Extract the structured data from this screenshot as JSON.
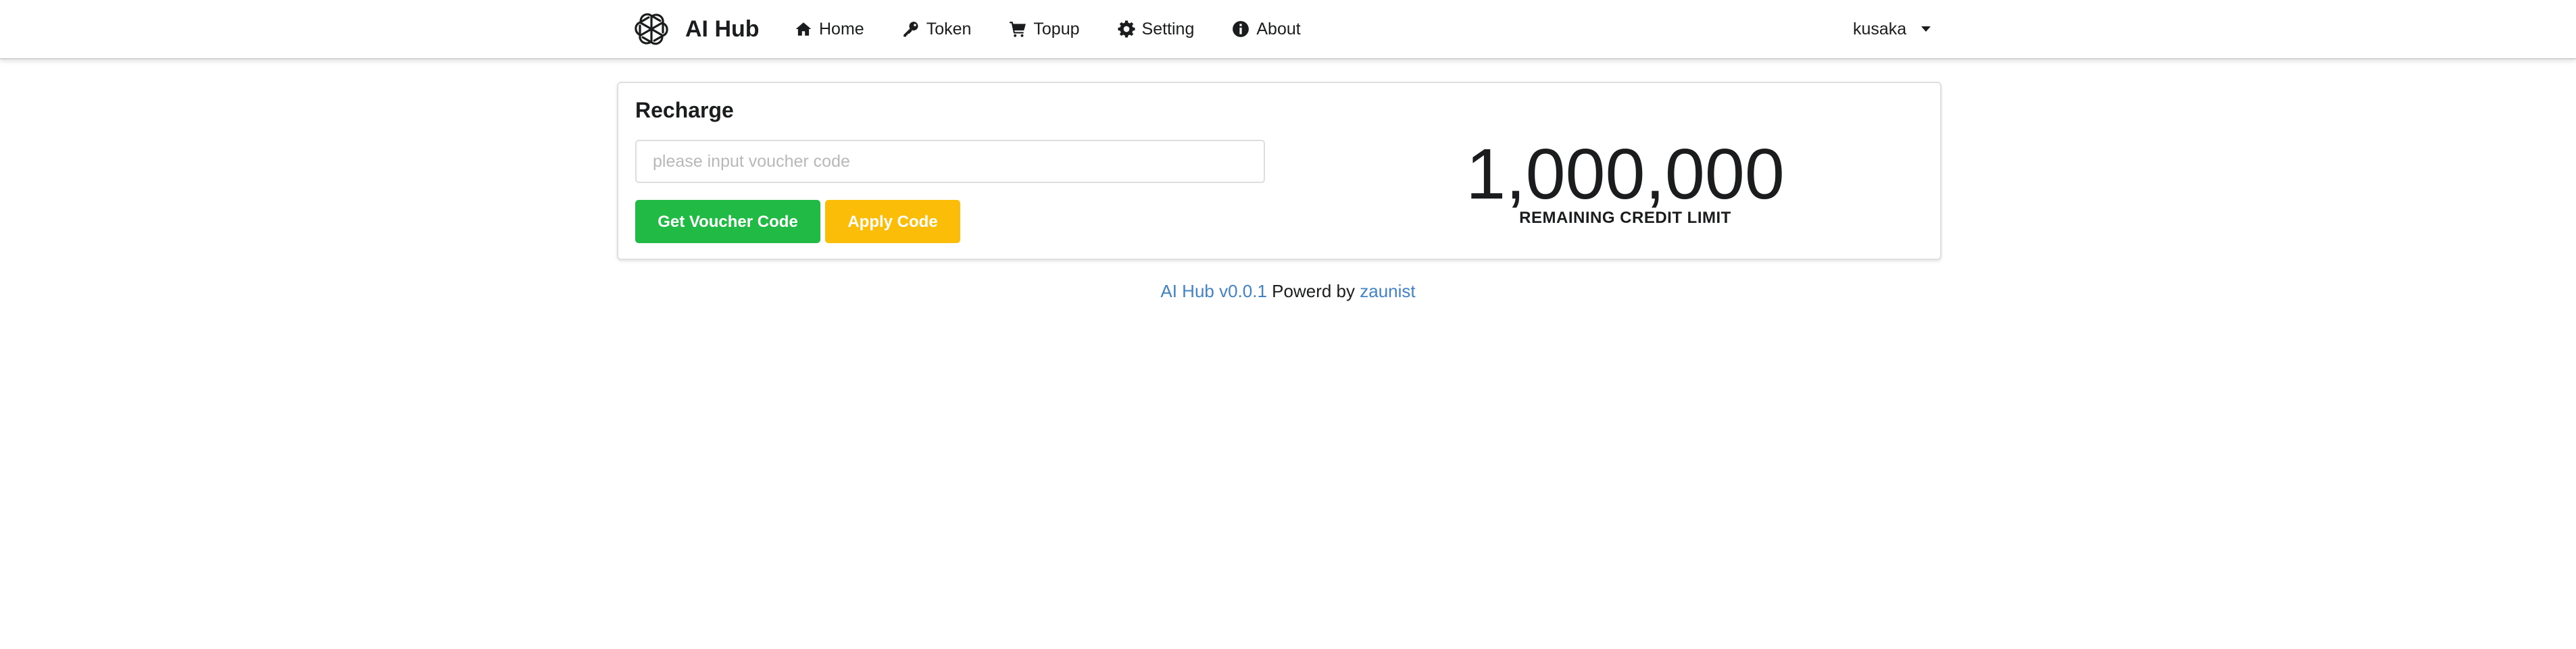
{
  "app": {
    "name": "AI Hub",
    "logo_icon": "openai-logo-icon"
  },
  "nav": {
    "items": [
      {
        "label": "Home",
        "icon": "home-icon"
      },
      {
        "label": "Token",
        "icon": "key-icon"
      },
      {
        "label": "Topup",
        "icon": "cart-icon"
      },
      {
        "label": "Setting",
        "icon": "gear-icon"
      },
      {
        "label": "About",
        "icon": "info-icon"
      }
    ],
    "user": {
      "name": "kusaka",
      "icon": "caret-down-icon"
    }
  },
  "recharge": {
    "title": "Recharge",
    "input": {
      "placeholder": "please input voucher code",
      "value": ""
    },
    "get_voucher_label": "Get Voucher Code",
    "apply_label": "Apply Code",
    "get_voucher_color": "#21ba45",
    "apply_color": "#fbbd08"
  },
  "credit": {
    "value": "1,000,000",
    "label": "REMAINING CREDIT LIMIT"
  },
  "footer": {
    "version_link": "AI Hub v0.0.1",
    "powered_text": "Powerd by",
    "author_link": "zaunist",
    "link_color": "#4183c4"
  }
}
